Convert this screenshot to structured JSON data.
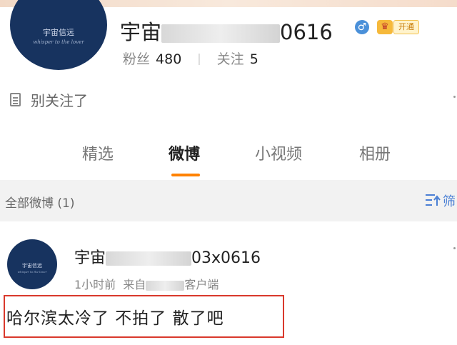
{
  "profile": {
    "avatar": {
      "brand": "宇宙信远",
      "sub": "whisper to the lover"
    },
    "name_prefix": "宇宙",
    "name_suffix": "0616",
    "gender_icon": "male-icon",
    "gender_symbol": "♂",
    "vip_icon": "crown-icon",
    "vip_symbol": "♛",
    "vip_label": "开通",
    "fans_label": "粉丝",
    "fans_count": "480",
    "separator": "|",
    "following_label": "关注",
    "following_count": "5",
    "bio_icon": "document-icon",
    "bio": "别关注了"
  },
  "tabs": [
    {
      "label": "精选"
    },
    {
      "label": "微博",
      "active": true
    },
    {
      "label": "小视频"
    },
    {
      "label": "相册"
    }
  ],
  "filter": {
    "count_label": "全部微博 (1)",
    "sort_icon": "sort-filter-icon",
    "sort_label": "筛"
  },
  "post": {
    "avatar": {
      "brand": "宇宙信远",
      "sub": "whisper to the lover"
    },
    "author_prefix": "宇宙",
    "author_suffix": "03x0616",
    "time": "1小时前",
    "source_prefix": "来自",
    "source_suffix": "客户端",
    "text": "哈尔滨太冷了 不拍了 散了吧"
  },
  "colors": {
    "accent": "#ff8200",
    "avatar_bg": "#17335f",
    "highlight_box": "#d9392c",
    "link": "#4a7fd4"
  }
}
